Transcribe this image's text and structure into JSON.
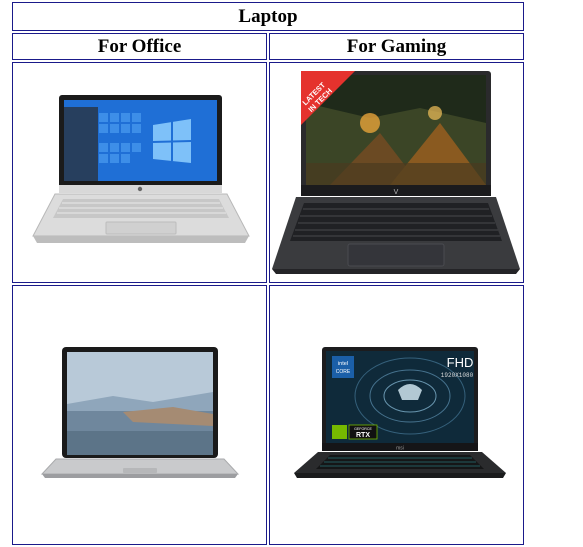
{
  "table": {
    "caption": "Laptop",
    "columns": [
      "For Office",
      "For Gaming"
    ],
    "badge_text_line1": "LATEST",
    "badge_text_line2": "IN TECH",
    "gaming2_screen_text": "FHD",
    "gaming2_resolution": "1920X1080",
    "gaming2_chip_brand": "intel",
    "gaming2_chip_model": "CORE",
    "gaming2_gpu_line": "GEFORCE",
    "gaming2_gpu_text": "RTX",
    "gaming2_deck_brand": "msi"
  },
  "colors": {
    "border": "#1a1a8a",
    "win_blue": "#1f6fd6",
    "badge_red": "#e5322d",
    "rtx_green": "#76b900"
  },
  "icons": {
    "office_laptop_1": "hp-laptop-windows-icon",
    "gaming_laptop_1": "hp-victus-gaming-laptop-icon",
    "office_laptop_2": "surface-laptop-icon",
    "gaming_laptop_2": "msi-gaming-laptop-icon"
  }
}
